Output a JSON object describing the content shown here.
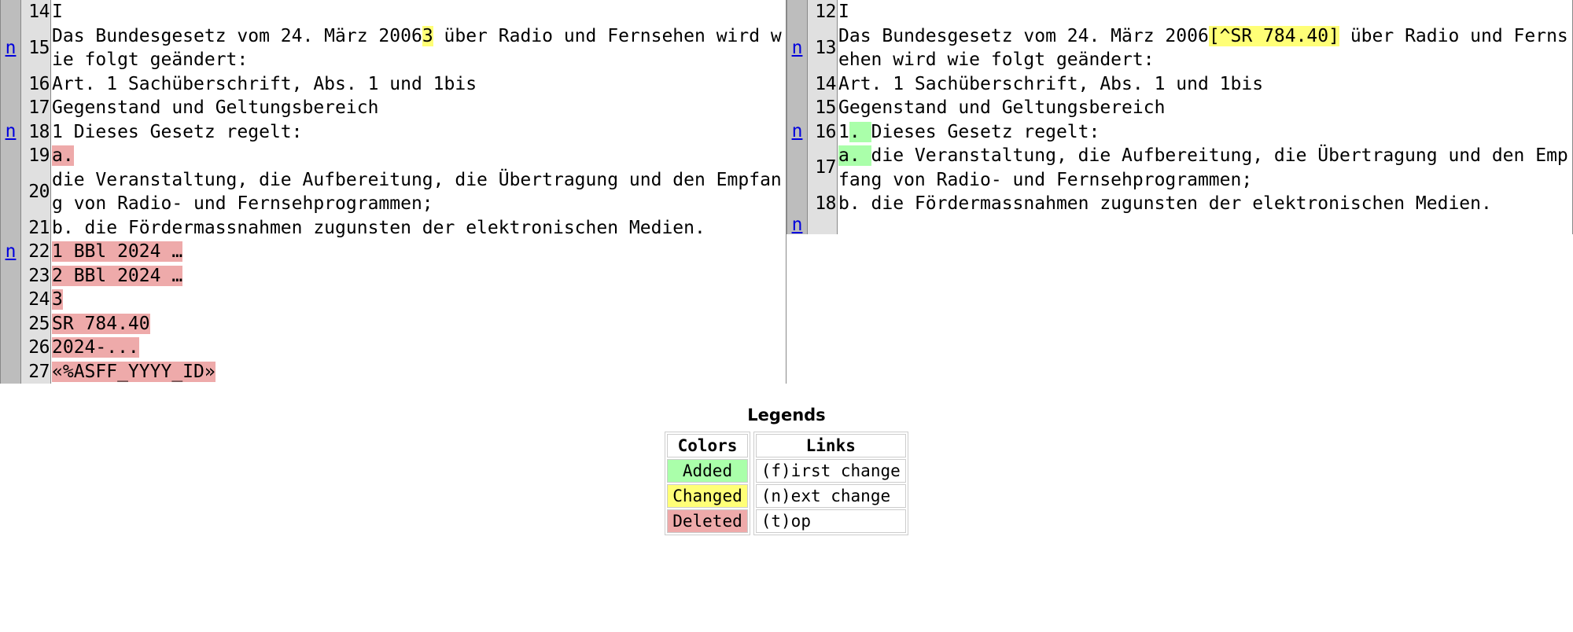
{
  "diff": {
    "left": {
      "rows": [
        {
          "link": "",
          "num": "14",
          "segments": [
            {
              "t": "I",
              "s": "plain"
            }
          ]
        },
        {
          "link": "n",
          "num": "15",
          "segments": [
            {
              "t": "Das Bundesgesetz vom 24. März 2006",
              "s": "plain"
            },
            {
              "t": "3",
              "s": "change"
            },
            {
              "t": " über Radio und Fernsehen wird wie folgt geändert:",
              "s": "plain"
            }
          ]
        },
        {
          "link": "",
          "num": "16",
          "segments": [
            {
              "t": "Art. 1 Sachüberschrift, Abs. 1 und 1bis",
              "s": "plain"
            }
          ]
        },
        {
          "link": "",
          "num": "17",
          "segments": [
            {
              "t": "Gegenstand und Geltungsbereich",
              "s": "plain"
            }
          ]
        },
        {
          "link": "n",
          "num": "18",
          "segments": [
            {
              "t": "1 Dieses Gesetz regelt:",
              "s": "plain"
            }
          ]
        },
        {
          "link": "",
          "num": "19",
          "segments": [
            {
              "t": "a.",
              "s": "del"
            }
          ]
        },
        {
          "link": "",
          "num": "20",
          "segments": [
            {
              "t": "die Veranstaltung, die Aufbereitung, die Übertragung und den Empfang von Radio- und Fernsehprogrammen;",
              "s": "plain"
            }
          ]
        },
        {
          "link": "",
          "num": "21",
          "segments": [
            {
              "t": "b. die Fördermassnahmen zugunsten der elektronischen Medien.",
              "s": "plain"
            }
          ]
        },
        {
          "link": "n",
          "num": "22",
          "segments": [
            {
              "t": "1 BBl 2024 …",
              "s": "del"
            }
          ]
        },
        {
          "link": "",
          "num": "23",
          "segments": [
            {
              "t": "2 BBl 2024 …",
              "s": "del"
            }
          ]
        },
        {
          "link": "",
          "num": "24",
          "segments": [
            {
              "t": "3",
              "s": "del"
            }
          ]
        },
        {
          "link": "",
          "num": "25",
          "segments": [
            {
              "t": "SR 784.40",
              "s": "del"
            }
          ]
        },
        {
          "link": "",
          "num": "26",
          "segments": [
            {
              "t": "2024-...",
              "s": "del"
            }
          ]
        },
        {
          "link": "",
          "num": "27",
          "segments": [
            {
              "t": "«%ASFF_YYYY_ID»",
              "s": "del"
            }
          ]
        }
      ]
    },
    "right": {
      "rows": [
        {
          "link": "",
          "num": "12",
          "segments": [
            {
              "t": "I",
              "s": "plain"
            }
          ]
        },
        {
          "link": "n",
          "num": "13",
          "segments": [
            {
              "t": "Das Bundesgesetz vom 24. März 2006",
              "s": "plain"
            },
            {
              "t": "[^SR 784.40]",
              "s": "change"
            },
            {
              "t": " über Radio und Fernsehen wird wie folgt geändert:",
              "s": "plain"
            }
          ]
        },
        {
          "link": "",
          "num": "14",
          "segments": [
            {
              "t": "Art. 1 Sachüberschrift, Abs. 1 und 1bis",
              "s": "plain"
            }
          ]
        },
        {
          "link": "",
          "num": "15",
          "segments": [
            {
              "t": "Gegenstand und Geltungsbereich",
              "s": "plain"
            }
          ]
        },
        {
          "link": "n",
          "num": "16",
          "segments": [
            {
              "t": "1",
              "s": "plain"
            },
            {
              "t": ". ",
              "s": "add"
            },
            {
              "t": "Dieses Gesetz regelt:",
              "s": "plain"
            }
          ]
        },
        {
          "link": "",
          "num": "17",
          "segments": [
            {
              "t": "a. ",
              "s": "add"
            },
            {
              "t": "die Veranstaltung, die Aufbereitung, die Übertragung und den Empfang von Radio- und Fernsehprogrammen;",
              "s": "plain"
            }
          ]
        },
        {
          "link": "",
          "num": "18",
          "segments": [
            {
              "t": "b. die Fördermassnahmen zugunsten der elektronischen Medien.",
              "s": "plain"
            }
          ]
        },
        {
          "link": "n",
          "num": "",
          "segments": [
            {
              "t": "",
              "s": "plain"
            }
          ]
        }
      ]
    }
  },
  "legends": {
    "title": "Legends",
    "colors": {
      "header": "Colors",
      "rows": [
        {
          "label": "Added",
          "color": "#aaffaa"
        },
        {
          "label": "Changed",
          "color": "#ffff77"
        },
        {
          "label": "Deleted",
          "color": "#eeaaaa"
        }
      ]
    },
    "links": {
      "header": "Links",
      "rows": [
        {
          "label": "(f)irst change"
        },
        {
          "label": "(n)ext change"
        },
        {
          "label": "(t)op"
        }
      ]
    }
  },
  "link_label": "n"
}
